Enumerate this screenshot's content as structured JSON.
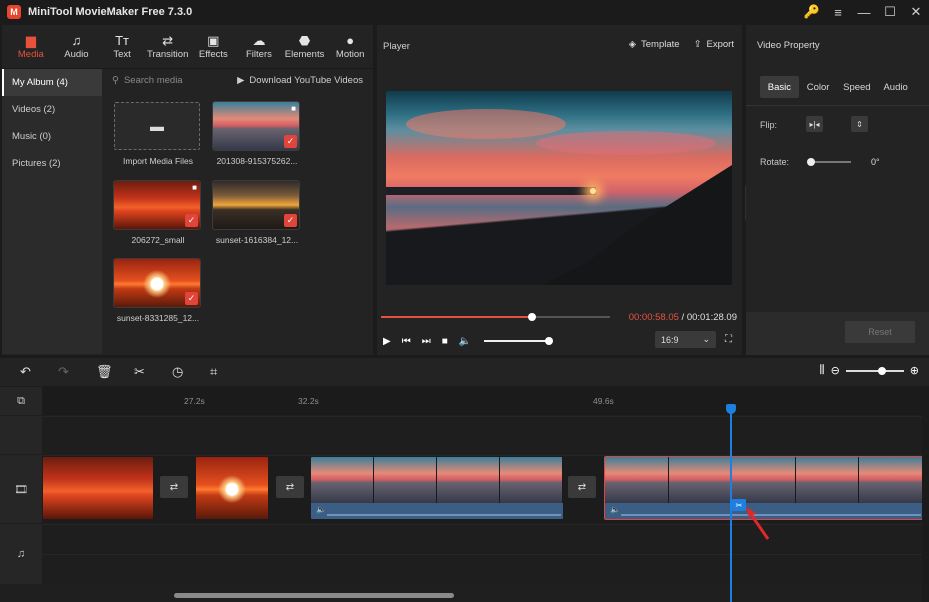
{
  "app": {
    "title": "MiniTool MovieMaker Free 7.3.0"
  },
  "window_controls": [
    "key-icon",
    "menu-icon",
    "minimize-icon",
    "maximize-icon",
    "close-icon"
  ],
  "left_tabs": [
    {
      "label": "Media",
      "icon": "folder-icon",
      "active": true
    },
    {
      "label": "Audio",
      "icon": "music-note-icon"
    },
    {
      "label": "Text",
      "icon": "text-icon"
    },
    {
      "label": "Transition",
      "icon": "transition-icon"
    },
    {
      "label": "Effects",
      "icon": "effects-icon"
    },
    {
      "label": "Filters",
      "icon": "filters-icon"
    },
    {
      "label": "Elements",
      "icon": "elements-icon"
    },
    {
      "label": "Motion",
      "icon": "motion-icon"
    }
  ],
  "album_nav": [
    {
      "label": "My Album (4)",
      "active": true
    },
    {
      "label": "Videos (2)"
    },
    {
      "label": "Music (0)"
    },
    {
      "label": "Pictures (2)"
    }
  ],
  "media": {
    "search_placeholder": "Search media",
    "youtube_label": "Download YouTube Videos",
    "import_label": "Import Media Files",
    "items": [
      {
        "name": "201308-915375262..."
      },
      {
        "name": "206272_small"
      },
      {
        "name": "sunset-1616384_12..."
      },
      {
        "name": "sunset-8331285_12..."
      }
    ]
  },
  "player": {
    "title": "Player",
    "template_label": "Template",
    "export_label": "Export",
    "current_time": "00:00:58.05",
    "separator": " / ",
    "total_time": "00:01:28.09",
    "progress_fraction": 0.66,
    "aspect": "16:9"
  },
  "property": {
    "title": "Video Property",
    "tabs": [
      "Basic",
      "Color",
      "Speed",
      "Audio"
    ],
    "flip_label": "Flip:",
    "rotate_label": "Rotate:",
    "rotate_value": "0°",
    "reset_label": "Reset"
  },
  "timeline": {
    "ruler": [
      "27.2s",
      "32.2s",
      "49.6s"
    ]
  },
  "colors": {
    "accent": "#e8523d",
    "playhead": "#1f7fe0",
    "selection": "#e0443a"
  }
}
